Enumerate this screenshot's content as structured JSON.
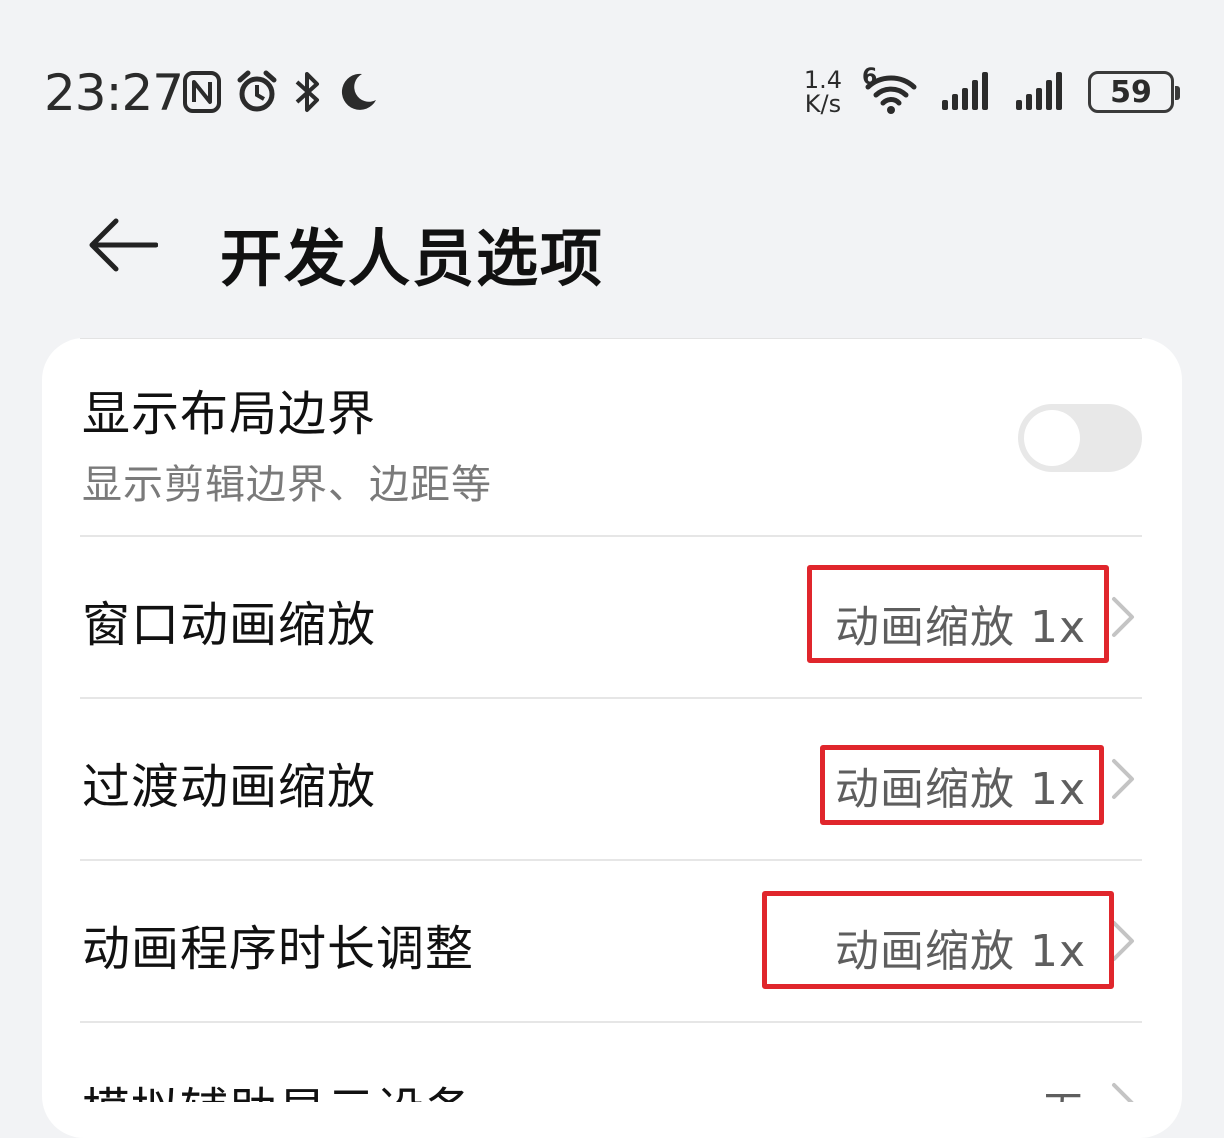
{
  "status_bar": {
    "time": "23:27",
    "net_speed_value": "1.4",
    "net_speed_unit": "K/s",
    "wifi_label": "6",
    "battery": "59",
    "icons": [
      "nfc-icon",
      "alarm-icon",
      "bluetooth-icon",
      "do-not-disturb-icon",
      "wifi-icon",
      "signal-icon",
      "signal-icon",
      "battery-icon"
    ]
  },
  "header": {
    "title": "开发人员选项",
    "back_icon": "arrow-left-icon"
  },
  "settings": {
    "show_layout_bounds": {
      "title": "显示布局边界",
      "subtitle": "显示剪辑边界、边距等",
      "enabled": false
    },
    "window_animation_scale": {
      "title": "窗口动画缩放",
      "value": "动画缩放 1x"
    },
    "transition_animation_scale": {
      "title": "过渡动画缩放",
      "value": "动画缩放 1x"
    },
    "animator_duration_scale": {
      "title": "动画程序时长调整",
      "value": "动画缩放 1x"
    },
    "simulate_secondary_displays": {
      "title": "模拟辅助显示设备",
      "value": "无"
    }
  },
  "colors": {
    "highlight": "#e0262c",
    "background": "#f2f3f5",
    "card": "#ffffff"
  }
}
